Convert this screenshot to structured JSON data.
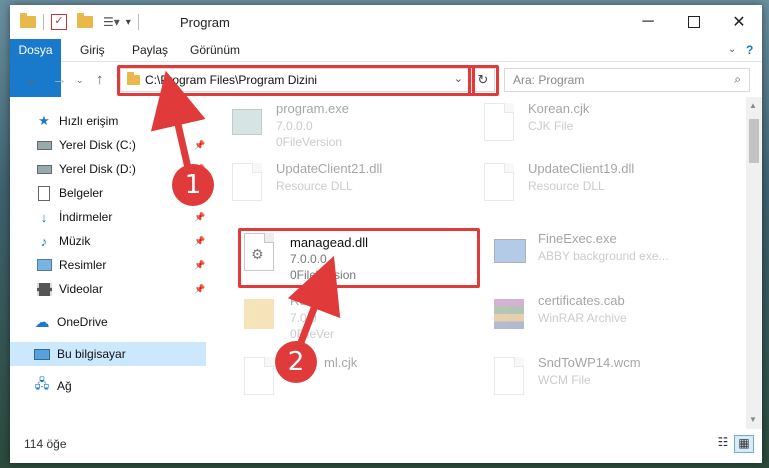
{
  "window": {
    "title": "Program"
  },
  "ribbon": {
    "tabs": [
      "Dosya",
      "Giriş",
      "Paylaş",
      "Görünüm"
    ]
  },
  "address": {
    "path": "C:\\Program Files\\Program Dizini"
  },
  "search": {
    "placeholder": "Ara: Program"
  },
  "sidebar": {
    "items": [
      {
        "label": "Hızlı erişim",
        "icon": "star-icon",
        "pinned": false
      },
      {
        "label": "Yerel Disk (C:)",
        "icon": "drive-icon",
        "pinned": true
      },
      {
        "label": "Yerel Disk (D:)",
        "icon": "drive-icon",
        "pinned": true
      },
      {
        "label": "Belgeler",
        "icon": "documents-icon",
        "pinned": true
      },
      {
        "label": "İndirmeler",
        "icon": "downloads-icon",
        "pinned": true
      },
      {
        "label": "Müzik",
        "icon": "music-icon",
        "pinned": true
      },
      {
        "label": "Resimler",
        "icon": "pictures-icon",
        "pinned": true
      },
      {
        "label": "Videolar",
        "icon": "videos-icon",
        "pinned": true
      },
      {
        "label": "OneDrive",
        "icon": "cloud-icon",
        "pinned": false
      },
      {
        "label": "Bu bilgisayar",
        "icon": "computer-icon",
        "pinned": false
      },
      {
        "label": "Ağ",
        "icon": "network-icon",
        "pinned": false
      }
    ]
  },
  "files": [
    {
      "name": "program.exe",
      "line2": "7.0.0.0",
      "line3": "0FileVersion"
    },
    {
      "name": "Korean.cjk",
      "line2": "CJK File",
      "line3": ""
    },
    {
      "name": "UpdateClient21.dll",
      "line2": "Resource DLL",
      "line3": ""
    },
    {
      "name": "UpdateClient19.dll",
      "line2": "Resource DLL",
      "line3": ""
    },
    {
      "name": "managead.dll",
      "line2": "7.0.0.0",
      "line3": "0FileVersion"
    },
    {
      "name": "FineExec.exe",
      "line2": "ABBY background exe...",
      "line3": ""
    },
    {
      "name": "Res",
      "line2": "7.0.0",
      "line3": "0FileVer"
    },
    {
      "name": "certificates.cab",
      "line2": "WinRAR Archive",
      "line3": ""
    },
    {
      "name": "ml.cjk",
      "line2": "",
      "line3": ""
    },
    {
      "name": "SndToWP14.wcm",
      "line2": "WCM File",
      "line3": ""
    }
  ],
  "status": {
    "count": "114 öğe"
  },
  "annotations": {
    "step1": "1",
    "step2": "2"
  },
  "colors": {
    "accent": "#1979ca",
    "highlight": "#e03a3a",
    "selected": "#cce8ff"
  }
}
